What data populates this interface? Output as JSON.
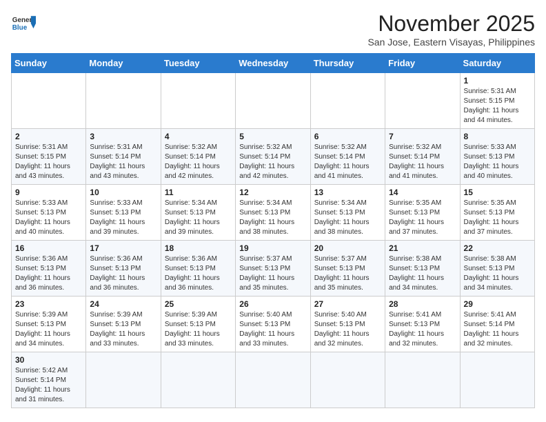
{
  "logo": {
    "general": "General",
    "blue": "Blue"
  },
  "title": "November 2025",
  "subtitle": "San Jose, Eastern Visayas, Philippines",
  "header": {
    "days": [
      "Sunday",
      "Monday",
      "Tuesday",
      "Wednesday",
      "Thursday",
      "Friday",
      "Saturday"
    ]
  },
  "weeks": [
    [
      {
        "day": "",
        "info": ""
      },
      {
        "day": "",
        "info": ""
      },
      {
        "day": "",
        "info": ""
      },
      {
        "day": "",
        "info": ""
      },
      {
        "day": "",
        "info": ""
      },
      {
        "day": "",
        "info": ""
      },
      {
        "day": "1",
        "info": "Sunrise: 5:31 AM\nSunset: 5:15 PM\nDaylight: 11 hours\nand 44 minutes."
      }
    ],
    [
      {
        "day": "2",
        "info": "Sunrise: 5:31 AM\nSunset: 5:15 PM\nDaylight: 11 hours\nand 43 minutes."
      },
      {
        "day": "3",
        "info": "Sunrise: 5:31 AM\nSunset: 5:14 PM\nDaylight: 11 hours\nand 43 minutes."
      },
      {
        "day": "4",
        "info": "Sunrise: 5:32 AM\nSunset: 5:14 PM\nDaylight: 11 hours\nand 42 minutes."
      },
      {
        "day": "5",
        "info": "Sunrise: 5:32 AM\nSunset: 5:14 PM\nDaylight: 11 hours\nand 42 minutes."
      },
      {
        "day": "6",
        "info": "Sunrise: 5:32 AM\nSunset: 5:14 PM\nDaylight: 11 hours\nand 41 minutes."
      },
      {
        "day": "7",
        "info": "Sunrise: 5:32 AM\nSunset: 5:14 PM\nDaylight: 11 hours\nand 41 minutes."
      },
      {
        "day": "8",
        "info": "Sunrise: 5:33 AM\nSunset: 5:13 PM\nDaylight: 11 hours\nand 40 minutes."
      }
    ],
    [
      {
        "day": "9",
        "info": "Sunrise: 5:33 AM\nSunset: 5:13 PM\nDaylight: 11 hours\nand 40 minutes."
      },
      {
        "day": "10",
        "info": "Sunrise: 5:33 AM\nSunset: 5:13 PM\nDaylight: 11 hours\nand 39 minutes."
      },
      {
        "day": "11",
        "info": "Sunrise: 5:34 AM\nSunset: 5:13 PM\nDaylight: 11 hours\nand 39 minutes."
      },
      {
        "day": "12",
        "info": "Sunrise: 5:34 AM\nSunset: 5:13 PM\nDaylight: 11 hours\nand 38 minutes."
      },
      {
        "day": "13",
        "info": "Sunrise: 5:34 AM\nSunset: 5:13 PM\nDaylight: 11 hours\nand 38 minutes."
      },
      {
        "day": "14",
        "info": "Sunrise: 5:35 AM\nSunset: 5:13 PM\nDaylight: 11 hours\nand 37 minutes."
      },
      {
        "day": "15",
        "info": "Sunrise: 5:35 AM\nSunset: 5:13 PM\nDaylight: 11 hours\nand 37 minutes."
      }
    ],
    [
      {
        "day": "16",
        "info": "Sunrise: 5:36 AM\nSunset: 5:13 PM\nDaylight: 11 hours\nand 36 minutes."
      },
      {
        "day": "17",
        "info": "Sunrise: 5:36 AM\nSunset: 5:13 PM\nDaylight: 11 hours\nand 36 minutes."
      },
      {
        "day": "18",
        "info": "Sunrise: 5:36 AM\nSunset: 5:13 PM\nDaylight: 11 hours\nand 36 minutes."
      },
      {
        "day": "19",
        "info": "Sunrise: 5:37 AM\nSunset: 5:13 PM\nDaylight: 11 hours\nand 35 minutes."
      },
      {
        "day": "20",
        "info": "Sunrise: 5:37 AM\nSunset: 5:13 PM\nDaylight: 11 hours\nand 35 minutes."
      },
      {
        "day": "21",
        "info": "Sunrise: 5:38 AM\nSunset: 5:13 PM\nDaylight: 11 hours\nand 34 minutes."
      },
      {
        "day": "22",
        "info": "Sunrise: 5:38 AM\nSunset: 5:13 PM\nDaylight: 11 hours\nand 34 minutes."
      }
    ],
    [
      {
        "day": "23",
        "info": "Sunrise: 5:39 AM\nSunset: 5:13 PM\nDaylight: 11 hours\nand 34 minutes."
      },
      {
        "day": "24",
        "info": "Sunrise: 5:39 AM\nSunset: 5:13 PM\nDaylight: 11 hours\nand 33 minutes."
      },
      {
        "day": "25",
        "info": "Sunrise: 5:39 AM\nSunset: 5:13 PM\nDaylight: 11 hours\nand 33 minutes."
      },
      {
        "day": "26",
        "info": "Sunrise: 5:40 AM\nSunset: 5:13 PM\nDaylight: 11 hours\nand 33 minutes."
      },
      {
        "day": "27",
        "info": "Sunrise: 5:40 AM\nSunset: 5:13 PM\nDaylight: 11 hours\nand 32 minutes."
      },
      {
        "day": "28",
        "info": "Sunrise: 5:41 AM\nSunset: 5:13 PM\nDaylight: 11 hours\nand 32 minutes."
      },
      {
        "day": "29",
        "info": "Sunrise: 5:41 AM\nSunset: 5:14 PM\nDaylight: 11 hours\nand 32 minutes."
      }
    ],
    [
      {
        "day": "30",
        "info": "Sunrise: 5:42 AM\nSunset: 5:14 PM\nDaylight: 11 hours\nand 31 minutes."
      },
      {
        "day": "",
        "info": ""
      },
      {
        "day": "",
        "info": ""
      },
      {
        "day": "",
        "info": ""
      },
      {
        "day": "",
        "info": ""
      },
      {
        "day": "",
        "info": ""
      },
      {
        "day": "",
        "info": ""
      }
    ]
  ]
}
